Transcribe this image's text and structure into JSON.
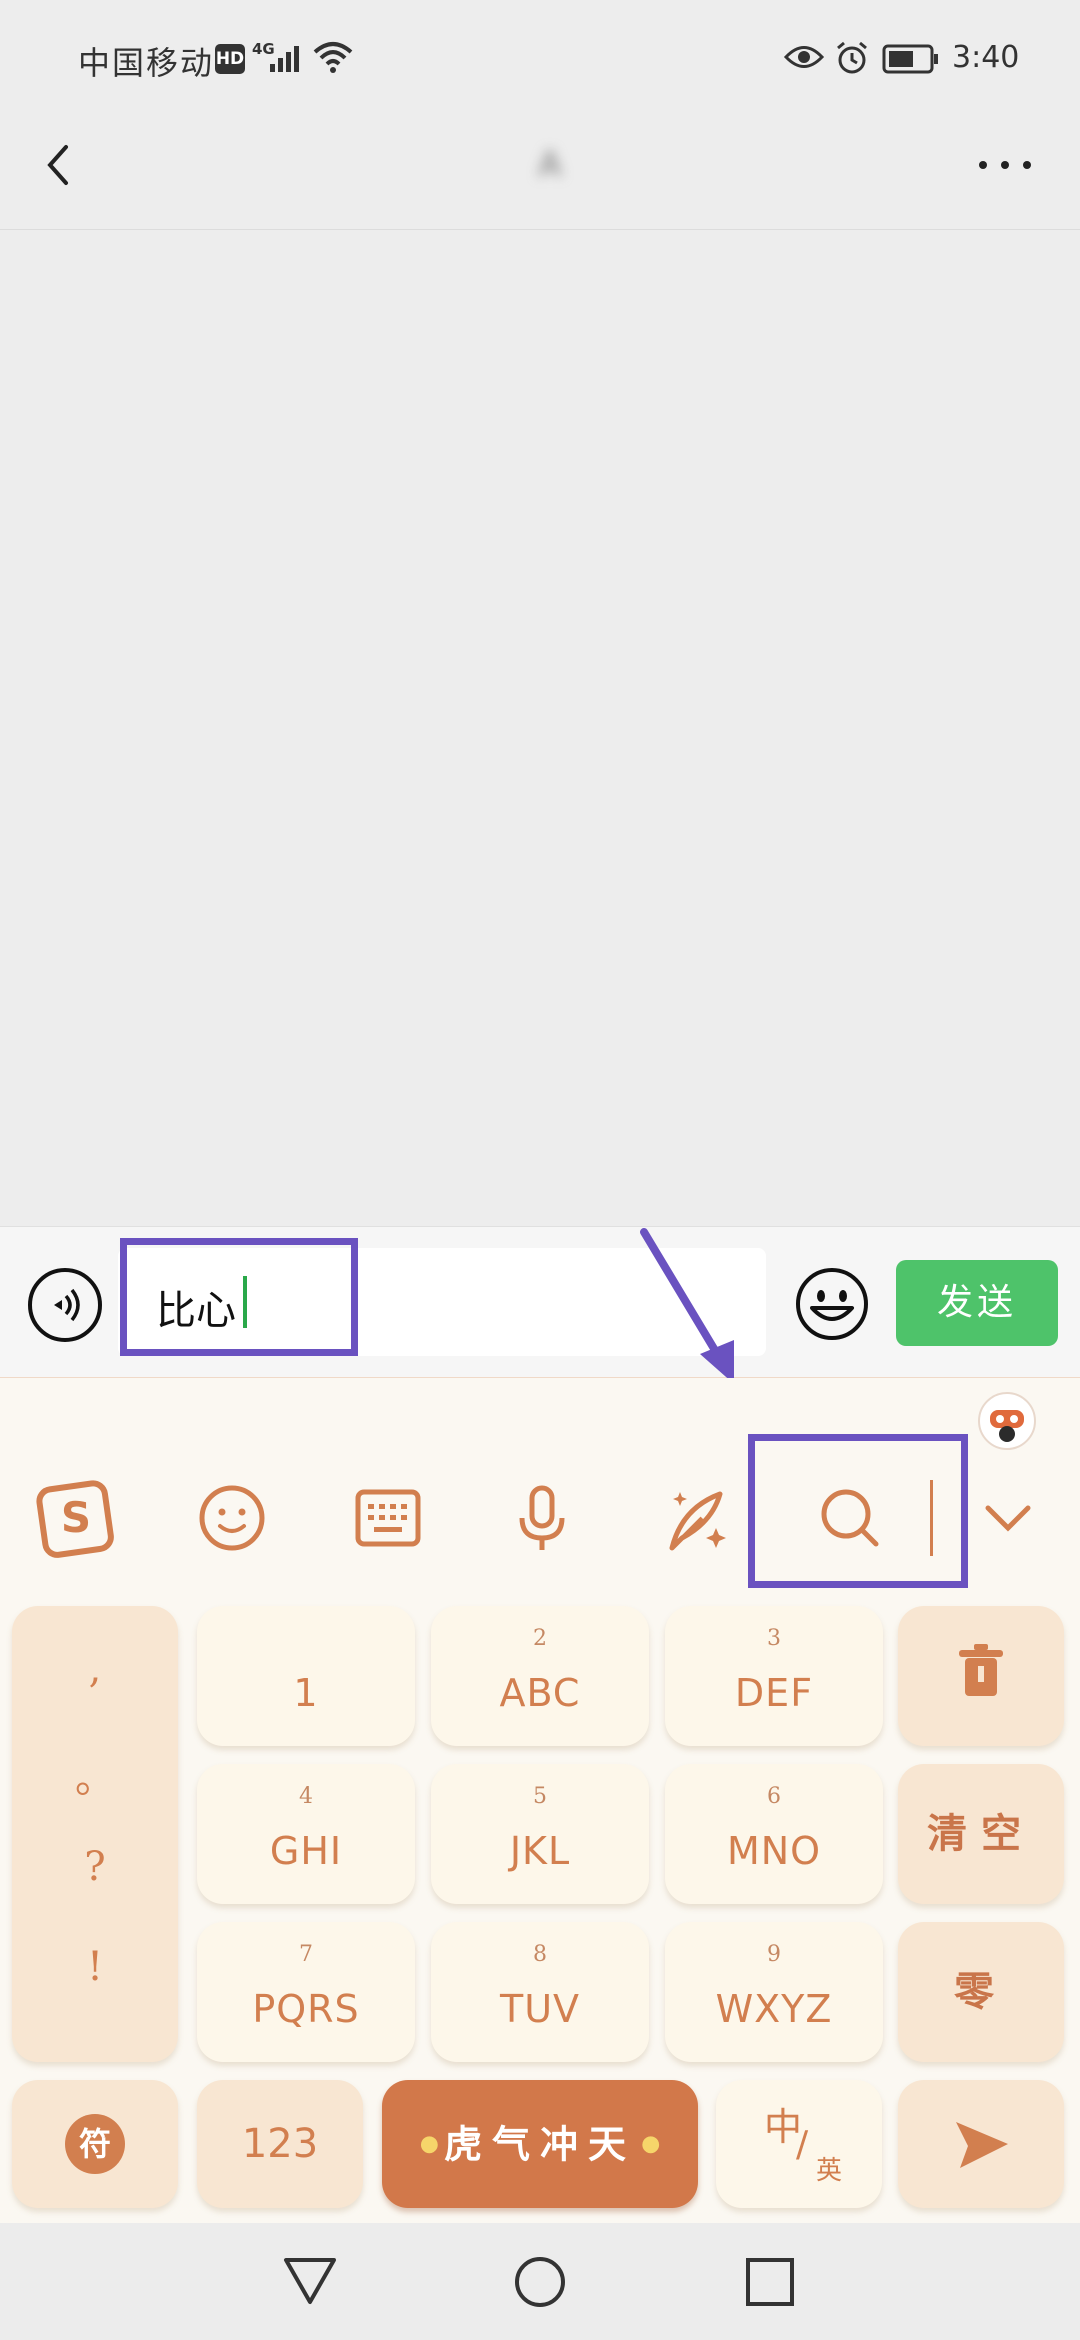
{
  "status_bar": {
    "carrier": "中国移动",
    "hd": "HD",
    "network": "4G",
    "time": "3:40"
  },
  "title_bar": {
    "title": "A"
  },
  "input_bar": {
    "input_value": "比心",
    "send_label": "发送"
  },
  "keyboard": {
    "punctuation": [
      ",",
      "。",
      "?",
      "!"
    ],
    "keys": [
      {
        "num": "",
        "main": "1"
      },
      {
        "num": "2",
        "main": "ABC"
      },
      {
        "num": "3",
        "main": "DEF"
      },
      {
        "num": "4",
        "main": "GHI"
      },
      {
        "num": "5",
        "main": "JKL"
      },
      {
        "num": "6",
        "main": "MNO"
      },
      {
        "num": "7",
        "main": "PQRS"
      },
      {
        "num": "8",
        "main": "TUV"
      },
      {
        "num": "9",
        "main": "WXYZ"
      }
    ],
    "clear_label": "清空",
    "zero_label": "零",
    "symbol_label": "符",
    "num_label": "123",
    "space_label": "虎气冲天",
    "lang_zh": "中",
    "lang_en": "英"
  },
  "colors": {
    "accent": "#d27f4f",
    "send_green": "#4ec36a",
    "highlight": "#6a52c0",
    "space_bg": "#d2784a"
  }
}
